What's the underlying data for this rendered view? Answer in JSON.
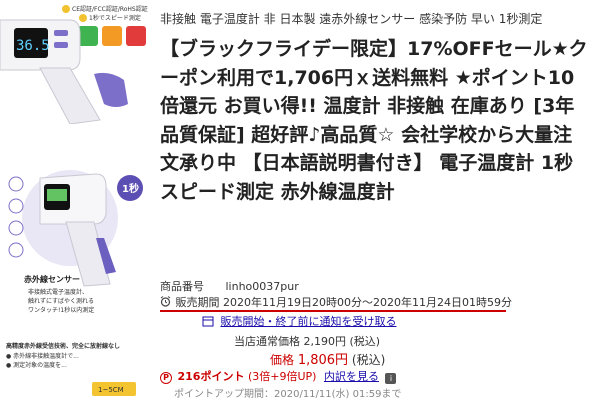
{
  "thumbnails": {
    "first": {
      "badges": [
        "CE認証/FCC認証/RoHS認証",
        "1秒でスピード測定"
      ],
      "reading": "36.5"
    },
    "second": {
      "badge": "1秒",
      "sensor_title": "赤外線センサー",
      "sensor_desc": [
        "非接触式電子温度計、",
        "触れずにすばやく測れる",
        "ワンタッチ!1秒以内測定"
      ]
    },
    "third": {
      "lines": [
        "高精度赤外線受信技術、完全に放射線なし",
        "● 赤外線非接触温度計で...",
        "● 測定対象の温度を..."
      ],
      "distance": "1~5CM"
    }
  },
  "product": {
    "subtitle": "非接触 電子温度計 非 日本製 遠赤外線センサー 感染予防 早い 1秒測定",
    "title": "【ブラックフライデー限定】17%OFFセール★クーポン利用で1,706円ｘ送料無料 ★ポイント10倍還元 お買い得!! 温度計 非接触 在庫あり [3年品質保証] 超好評♪高品質☆ 会社学校から大量注文承り中 【日本語説明書付き】 電子温度計 1秒スピード測定 赤外線温度計",
    "code_label": "商品番号",
    "code_value": "linho0037pur",
    "period": "販売期間 2020年11月19日20時00分～2020年11月24日01時59分",
    "notify_link": "販売開始・終了前に通知を受け取る",
    "normal_price_label": "当店通常価格",
    "normal_price_value": "2,190円",
    "normal_price_tax": "(税込)",
    "price_label": "価格",
    "price_value": "1,806円",
    "price_tax": "(税込)",
    "points_icon": "P",
    "points": "216ポイント",
    "points_detail": "(3倍+9倍UP)",
    "points_link": "内訳を見る",
    "points_date": "ポイントアップ期間：2020/11/11(水) 01:59まで"
  },
  "colors": {
    "accent_red": "#cc0000",
    "link_blue": "#1a0dab",
    "device_purple": "#7b6fc9"
  }
}
